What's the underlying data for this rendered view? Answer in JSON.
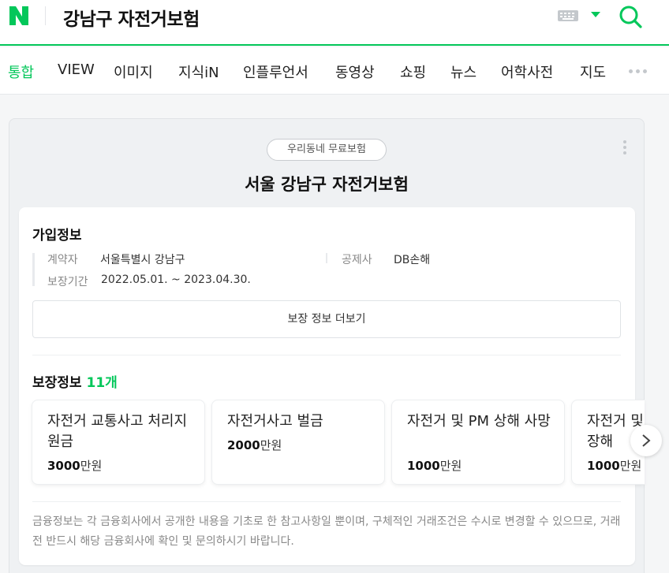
{
  "header": {
    "logo_letter": "N",
    "query": "강남구 자전거보험",
    "brand_color": "#03c75a"
  },
  "tabs": [
    {
      "label": "통합",
      "active": true
    },
    {
      "label": "VIEW"
    },
    {
      "label": "이미지"
    },
    {
      "label": "지식iN"
    },
    {
      "label": "인플루언서"
    },
    {
      "label": "동영상"
    },
    {
      "label": "쇼핑"
    },
    {
      "label": "뉴스"
    },
    {
      "label": "어학사전"
    },
    {
      "label": "지도"
    }
  ],
  "card": {
    "badge": "우리동네 무료보험",
    "title": "서울 강남구 자전거보험"
  },
  "join_info": {
    "title": "가입정보",
    "contractor_label": "계약자",
    "contractor_value": "서울특별시 강남구",
    "insurer_label": "공제사",
    "insurer_value": "DB손해",
    "period_label": "보장기간",
    "period_value": "2022.05.01. ~ 2023.04.30.",
    "more_button": "보장 정보 더보기"
  },
  "coverage": {
    "title": "보장정보",
    "count": "11개",
    "items": [
      {
        "name": "자전거 교통사고 처리지원금",
        "amount": "3000",
        "unit": "만원"
      },
      {
        "name": "자전거사고 벌금",
        "amount": "2000",
        "unit": "만원"
      },
      {
        "name": "자전거 및 PM 상해 사망",
        "amount": "1000",
        "unit": "만원"
      },
      {
        "name": "자전거 및 PM 상해 후유장해",
        "amount": "1000",
        "unit": "만원"
      }
    ]
  },
  "notice": "금융정보는 각 금융회사에서 공개한 내용을 기초로 한 참고사항일 뿐이며, 구체적인 거래조건은 수시로 변경할 수 있으므로, 거래전 반드시 해당 금융회사에 확인 및 문의하시기 바랍니다."
}
